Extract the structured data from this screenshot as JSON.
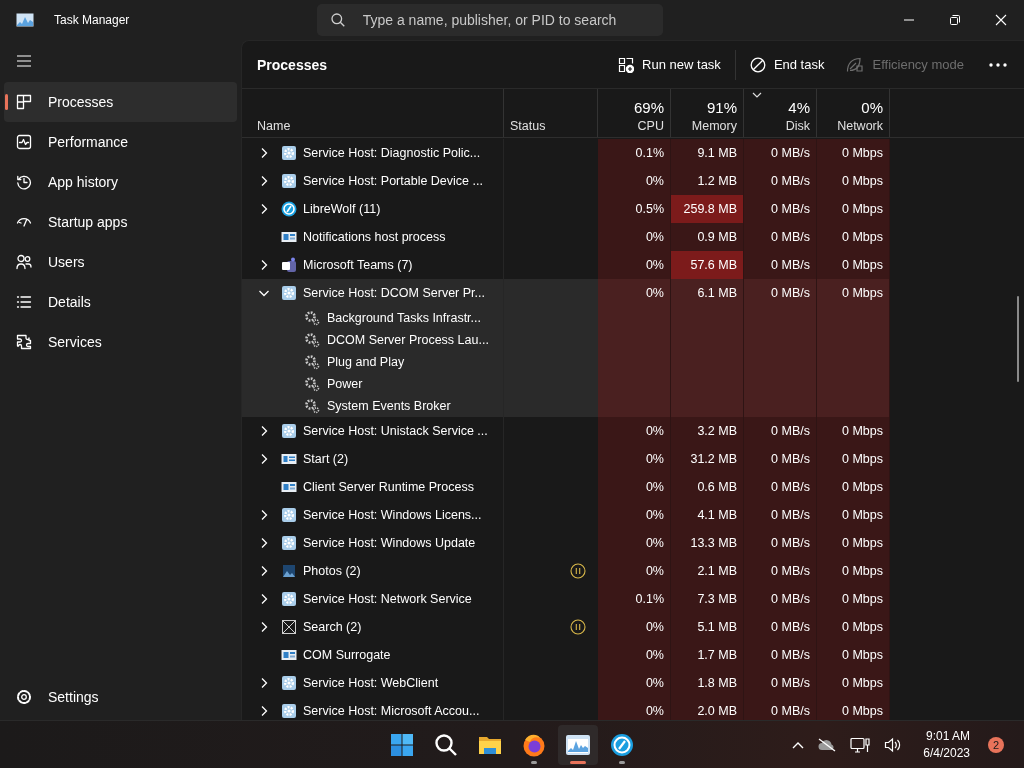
{
  "window": {
    "title": "Task Manager",
    "search_placeholder": "Type a name, publisher, or PID to search"
  },
  "sidebar": {
    "items": [
      {
        "label": "Processes",
        "selected": true
      },
      {
        "label": "Performance",
        "selected": false
      },
      {
        "label": "App history",
        "selected": false
      },
      {
        "label": "Startup apps",
        "selected": false
      },
      {
        "label": "Users",
        "selected": false
      },
      {
        "label": "Details",
        "selected": false
      },
      {
        "label": "Services",
        "selected": false
      }
    ],
    "settings": {
      "label": "Settings"
    }
  },
  "toolbar": {
    "title": "Processes",
    "actions": [
      {
        "label": "Run new task",
        "disabled": false
      },
      {
        "label": "End task",
        "disabled": false
      },
      {
        "label": "Efficiency mode",
        "disabled": true
      }
    ]
  },
  "table": {
    "columns": [
      {
        "label": "Name",
        "sorted": false
      },
      {
        "label": "Status",
        "sorted": false
      },
      {
        "label": "CPU",
        "total": "69%",
        "sorted": false
      },
      {
        "label": "Memory",
        "total": "91%",
        "sorted": false
      },
      {
        "label": "Disk",
        "total": "4%",
        "sorted": true
      },
      {
        "label": "Network",
        "total": "0%",
        "sorted": false
      }
    ],
    "rows": [
      {
        "name": "Service Host: Diagnostic Polic...",
        "kind": "service",
        "expandable": true,
        "expanded": false,
        "suspended": false,
        "cpu": "0.1%",
        "memory": "9.1 MB",
        "memory_high": false,
        "disk": "0 MB/s",
        "network": "0 Mbps"
      },
      {
        "name": "Service Host: Portable Device ...",
        "kind": "service",
        "expandable": true,
        "expanded": false,
        "suspended": false,
        "cpu": "0%",
        "memory": "1.2 MB",
        "memory_high": false,
        "disk": "0 MB/s",
        "network": "0 Mbps"
      },
      {
        "name": "LibreWolf (11)",
        "kind": "browser",
        "expandable": true,
        "expanded": false,
        "suspended": false,
        "cpu": "0.5%",
        "memory": "259.8 MB",
        "memory_high": true,
        "disk": "0 MB/s",
        "network": "0 Mbps"
      },
      {
        "name": "Notifications host process",
        "kind": "window",
        "expandable": false,
        "expanded": false,
        "suspended": false,
        "cpu": "0%",
        "memory": "0.9 MB",
        "memory_high": false,
        "disk": "0 MB/s",
        "network": "0 Mbps"
      },
      {
        "name": "Microsoft Teams (7)",
        "kind": "teams",
        "expandable": true,
        "expanded": false,
        "suspended": false,
        "cpu": "0%",
        "memory": "57.6 MB",
        "memory_high": true,
        "disk": "0 MB/s",
        "network": "0 Mbps"
      },
      {
        "name": "Service Host: DCOM Server Pr...",
        "kind": "service",
        "expandable": true,
        "expanded": true,
        "suspended": false,
        "cpu": "0%",
        "memory": "6.1 MB",
        "memory_high": false,
        "disk": "0 MB/s",
        "network": "0 Mbps",
        "children": [
          {
            "name": "Background Tasks Infrastr..."
          },
          {
            "name": "DCOM Server Process Lau..."
          },
          {
            "name": "Plug and Play"
          },
          {
            "name": "Power"
          },
          {
            "name": "System Events Broker"
          }
        ]
      },
      {
        "name": "Service Host: Unistack Service ...",
        "kind": "service",
        "expandable": true,
        "expanded": false,
        "suspended": false,
        "cpu": "0%",
        "memory": "3.2 MB",
        "memory_high": false,
        "disk": "0 MB/s",
        "network": "0 Mbps"
      },
      {
        "name": "Start (2)",
        "kind": "app",
        "expandable": true,
        "expanded": false,
        "suspended": false,
        "cpu": "0%",
        "memory": "31.2 MB",
        "memory_high": false,
        "disk": "0 MB/s",
        "network": "0 Mbps"
      },
      {
        "name": "Client Server Runtime Process",
        "kind": "window",
        "expandable": false,
        "expanded": false,
        "suspended": false,
        "cpu": "0%",
        "memory": "0.6 MB",
        "memory_high": false,
        "disk": "0 MB/s",
        "network": "0 Mbps"
      },
      {
        "name": "Service Host: Windows Licens...",
        "kind": "service",
        "expandable": true,
        "expanded": false,
        "suspended": false,
        "cpu": "0%",
        "memory": "4.1 MB",
        "memory_high": false,
        "disk": "0 MB/s",
        "network": "0 Mbps"
      },
      {
        "name": "Service Host: Windows Update",
        "kind": "service",
        "expandable": true,
        "expanded": false,
        "suspended": false,
        "cpu": "0%",
        "memory": "13.3 MB",
        "memory_high": false,
        "disk": "0 MB/s",
        "network": "0 Mbps"
      },
      {
        "name": "Photos (2)",
        "kind": "photos",
        "expandable": true,
        "expanded": false,
        "suspended": true,
        "cpu": "0%",
        "memory": "2.1 MB",
        "memory_high": false,
        "disk": "0 MB/s",
        "network": "0 Mbps"
      },
      {
        "name": "Service Host: Network Service",
        "kind": "service",
        "expandable": true,
        "expanded": false,
        "suspended": false,
        "cpu": "0.1%",
        "memory": "7.3 MB",
        "memory_high": false,
        "disk": "0 MB/s",
        "network": "0 Mbps"
      },
      {
        "name": "Search (2)",
        "kind": "blank",
        "expandable": true,
        "expanded": false,
        "suspended": true,
        "cpu": "0%",
        "memory": "5.1 MB",
        "memory_high": false,
        "disk": "0 MB/s",
        "network": "0 Mbps"
      },
      {
        "name": "COM Surrogate",
        "kind": "window",
        "expandable": false,
        "expanded": false,
        "suspended": false,
        "cpu": "0%",
        "memory": "1.7 MB",
        "memory_high": false,
        "disk": "0 MB/s",
        "network": "0 Mbps"
      },
      {
        "name": "Service Host: WebClient",
        "kind": "service",
        "expandable": true,
        "expanded": false,
        "suspended": false,
        "cpu": "0%",
        "memory": "1.8 MB",
        "memory_high": false,
        "disk": "0 MB/s",
        "network": "0 Mbps"
      },
      {
        "name": "Service Host: Microsoft Accou...",
        "kind": "service",
        "expandable": true,
        "expanded": false,
        "suspended": false,
        "cpu": "0%",
        "memory": "2.0 MB",
        "memory_high": false,
        "disk": "0 MB/s",
        "network": "0 Mbps"
      }
    ]
  },
  "taskbar": {
    "apps": [
      {
        "kind": "start",
        "running": false,
        "active": false
      },
      {
        "kind": "search",
        "running": false,
        "active": false
      },
      {
        "kind": "explorer",
        "running": false,
        "active": false
      },
      {
        "kind": "firefox",
        "running": true,
        "active": false
      },
      {
        "kind": "taskmanager",
        "running": true,
        "active": true
      },
      {
        "kind": "browser",
        "running": true,
        "active": false
      }
    ],
    "time": "9:01 AM",
    "date": "6/4/2023",
    "notifications": "2"
  }
}
